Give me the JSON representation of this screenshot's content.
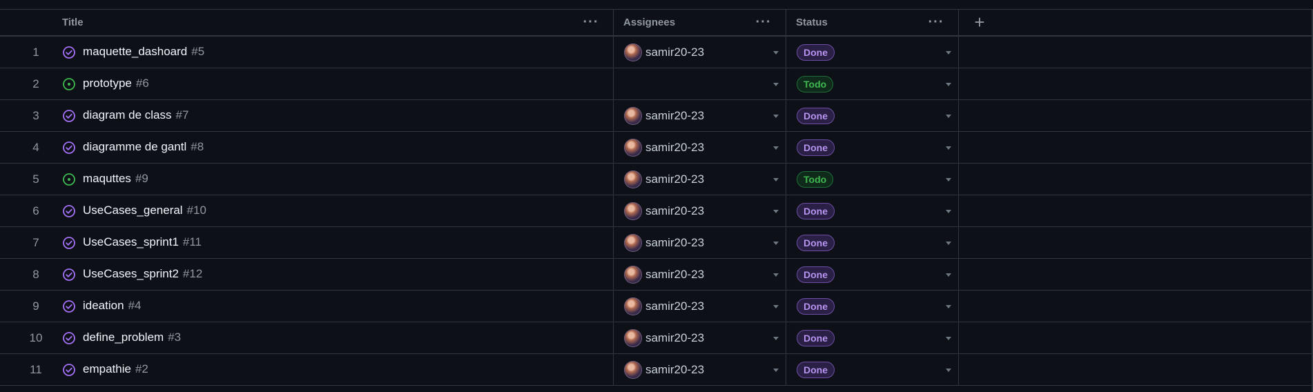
{
  "columns": {
    "title": "Title",
    "assignees": "Assignees",
    "status": "Status"
  },
  "colors": {
    "done_badge": "#b694f0",
    "todo_badge": "#3fb950",
    "closed_icon": "#a371f7",
    "open_icon": "#3fb950"
  },
  "rows": [
    {
      "num": "1",
      "title": "maquette_dashoard",
      "issue": "#5",
      "state": "closed",
      "assignee": "samir20-23",
      "status": "Done"
    },
    {
      "num": "2",
      "title": "prototype",
      "issue": "#6",
      "state": "open",
      "assignee": "",
      "status": "Todo"
    },
    {
      "num": "3",
      "title": "diagram de class",
      "issue": "#7",
      "state": "closed",
      "assignee": "samir20-23",
      "status": "Done"
    },
    {
      "num": "4",
      "title": "diagramme de gantl",
      "issue": "#8",
      "state": "closed",
      "assignee": "samir20-23",
      "status": "Done"
    },
    {
      "num": "5",
      "title": "maquttes",
      "issue": "#9",
      "state": "open",
      "assignee": "samir20-23",
      "status": "Todo"
    },
    {
      "num": "6",
      "title": "UseCases_general",
      "issue": "#10",
      "state": "closed",
      "assignee": "samir20-23",
      "status": "Done"
    },
    {
      "num": "7",
      "title": "UseCases_sprint1",
      "issue": "#11",
      "state": "closed",
      "assignee": "samir20-23",
      "status": "Done"
    },
    {
      "num": "8",
      "title": "UseCases_sprint2",
      "issue": "#12",
      "state": "closed",
      "assignee": "samir20-23",
      "status": "Done"
    },
    {
      "num": "9",
      "title": "ideation",
      "issue": "#4",
      "state": "closed",
      "assignee": "samir20-23",
      "status": "Done"
    },
    {
      "num": "10",
      "title": "define_problem",
      "issue": "#3",
      "state": "closed",
      "assignee": "samir20-23",
      "status": "Done"
    },
    {
      "num": "11",
      "title": "empathie",
      "issue": "#2",
      "state": "closed",
      "assignee": "samir20-23",
      "status": "Done"
    }
  ]
}
